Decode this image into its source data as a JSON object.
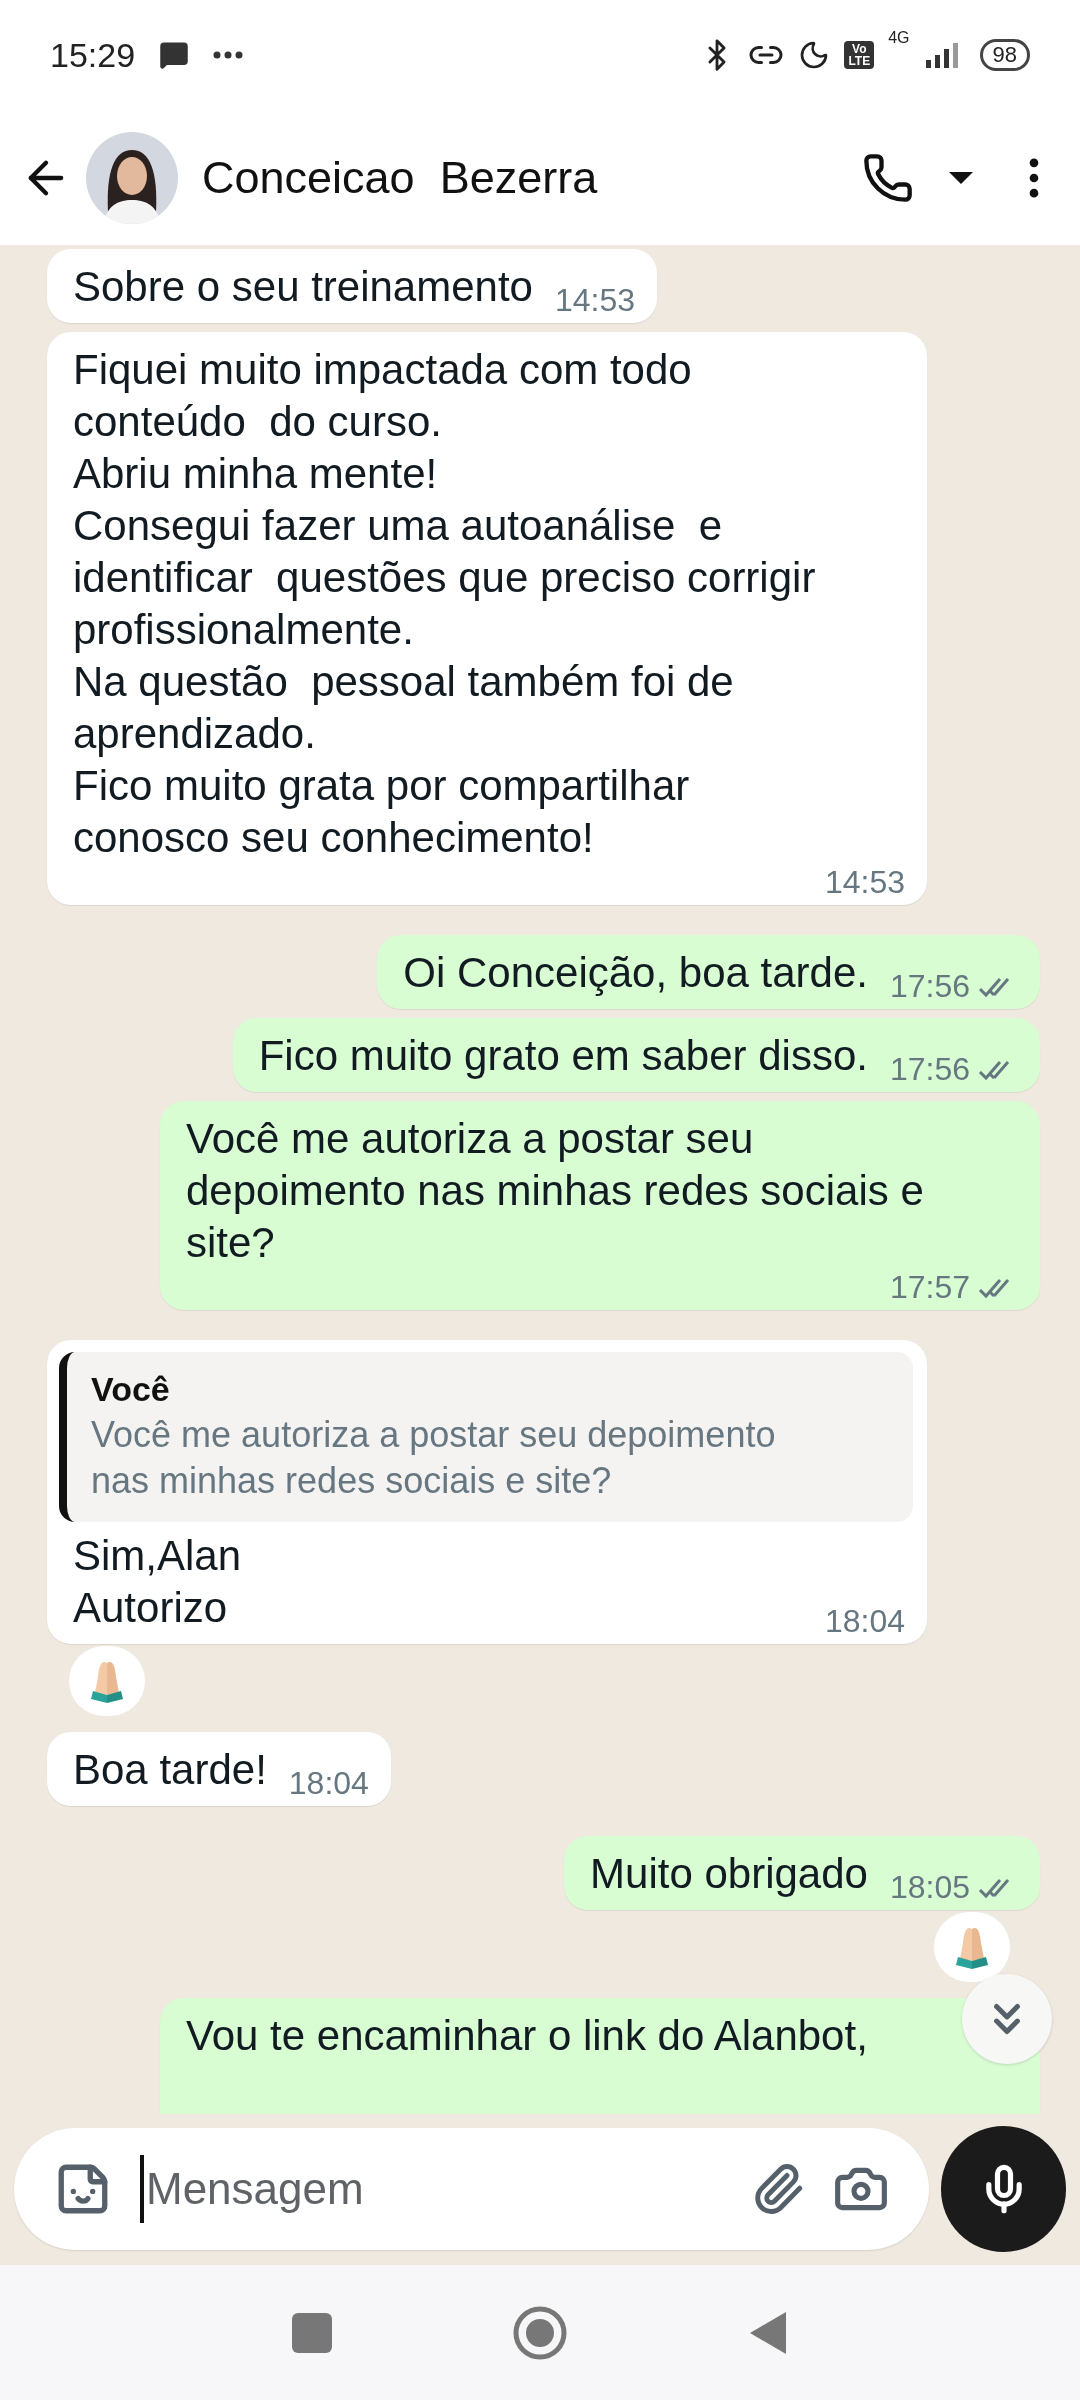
{
  "status_bar": {
    "time": "15:29",
    "volte": [
      "Vo",
      "LTE"
    ],
    "network": "4G",
    "battery": "98"
  },
  "header": {
    "contact_name": "Conceicao  Bezerra"
  },
  "messages": [
    {
      "kind": "received",
      "text": "Sobre o seu treinamento",
      "time": "14:53"
    },
    {
      "kind": "received",
      "text": "Fiquei muito impactada com todo\nconteúdo  do curso.\nAbriu minha mente!\nConsegui fazer uma autoanálise  e\nidentificar  questões que preciso corrigir\nprofissionalmente.\nNa questão  pessoal também foi de\naprendizado.\nFico muito grata por compartilhar\nconosco seu conhecimento!",
      "time": "14:53"
    },
    {
      "kind": "sent",
      "text": "Oi Conceição, boa tarde.",
      "time": "17:56",
      "delivered": true
    },
    {
      "kind": "sent",
      "text": "Fico muito grato em saber disso.",
      "time": "17:56",
      "delivered": true
    },
    {
      "kind": "sent",
      "text": "Você me autoriza a postar seu\ndepoimento nas minhas redes sociais e\nsite?",
      "time": "17:57",
      "delivered": true
    },
    {
      "kind": "received",
      "quote": {
        "author": "Você",
        "text": "Você me autoriza a postar seu depoimento\nnas minhas redes sociais e site?"
      },
      "text": "Sim,Alan\nAutorizo",
      "time": "18:04",
      "reacted": true
    },
    {
      "kind": "received",
      "text": "Boa tarde!",
      "time": "18:04"
    },
    {
      "kind": "sent",
      "text": "Muito obrigado",
      "time": "18:05",
      "delivered": true,
      "reacted": true
    },
    {
      "kind": "sent",
      "text": "Vou te encaminhar o link do Alanbot,"
    }
  ],
  "composer": {
    "placeholder": "Mensagem"
  }
}
